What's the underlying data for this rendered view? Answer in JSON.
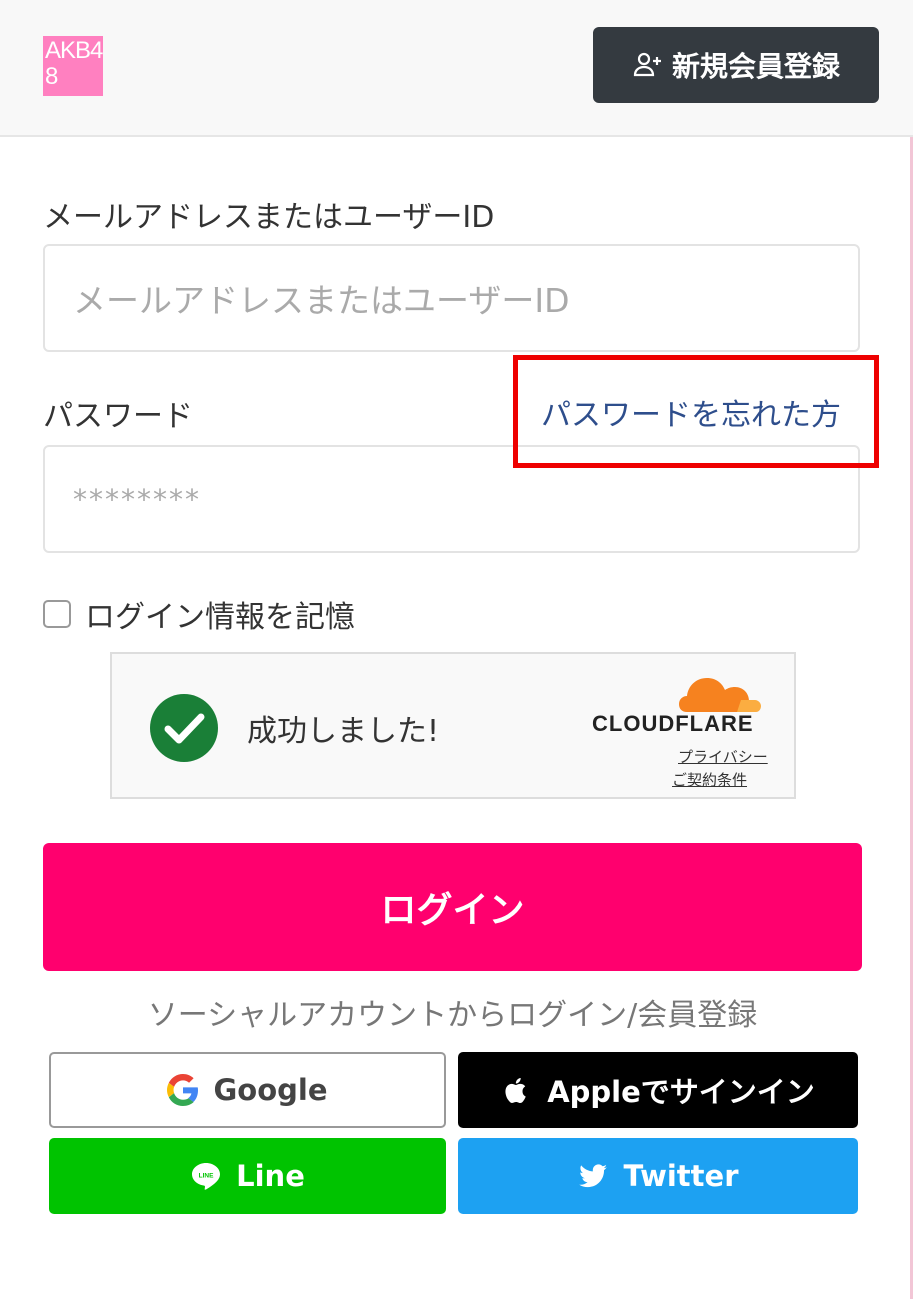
{
  "header": {
    "logo_text": "AKB48",
    "signup_label": "新規会員登録"
  },
  "form": {
    "email_label": "メールアドレスまたはユーザーID",
    "email_placeholder": "メールアドレスまたはユーザーID",
    "password_label": "パスワード",
    "forgot_link": "パスワードを忘れた方",
    "password_placeholder": "********",
    "remember_label": "ログイン情報を記憶",
    "remember_checked": false
  },
  "captcha": {
    "status": "成功しました!",
    "brand": "CLOUDFLARE",
    "privacy_link": "プライバシー",
    "terms_link": "ご契約条件"
  },
  "login_label": "ログイン",
  "social": {
    "caption": "ソーシャルアカウントからログイン/会員登録",
    "google_label": "Google",
    "apple_label": "Appleでサインイン",
    "line_label": "Line",
    "twitter_label": "Twitter"
  },
  "colors": {
    "login_button": "#ff006e",
    "header_button": "#343a40",
    "line": "#00c300",
    "twitter": "#1da1f2",
    "highlight": "#ee0000"
  }
}
